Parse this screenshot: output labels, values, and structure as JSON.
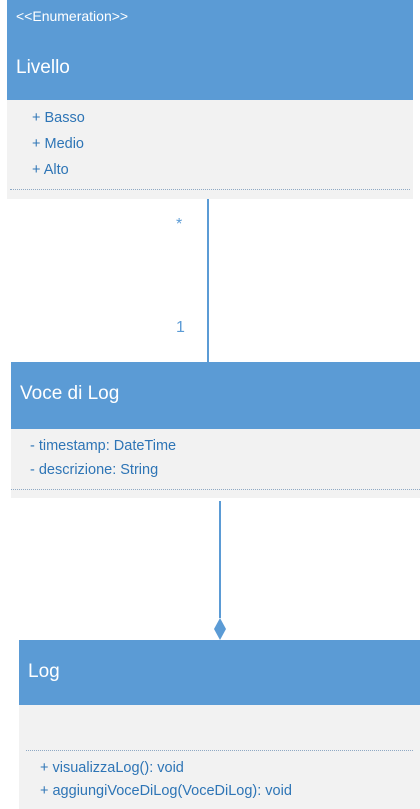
{
  "classes": {
    "livello": {
      "stereotype": "<<Enumeration>>",
      "name": "Livello",
      "items": [
        "+ Basso",
        "+ Medio",
        "+ Alto"
      ]
    },
    "voce_di_log": {
      "name": "Voce di Log",
      "attributes": [
        "- timestamp: DateTime",
        "- descrizione: String"
      ]
    },
    "log": {
      "name": "Log",
      "operations": [
        "+ visualizzaLog(): void",
        "+ aggiungiVoceDiLog(VoceDiLog): void"
      ]
    }
  },
  "associations": {
    "livello_voce": {
      "end_livello": "*",
      "end_voce": "1"
    }
  },
  "colors": {
    "header": "#5b9bd5",
    "body": "#f2f2f2",
    "text": "#2e75b6"
  }
}
